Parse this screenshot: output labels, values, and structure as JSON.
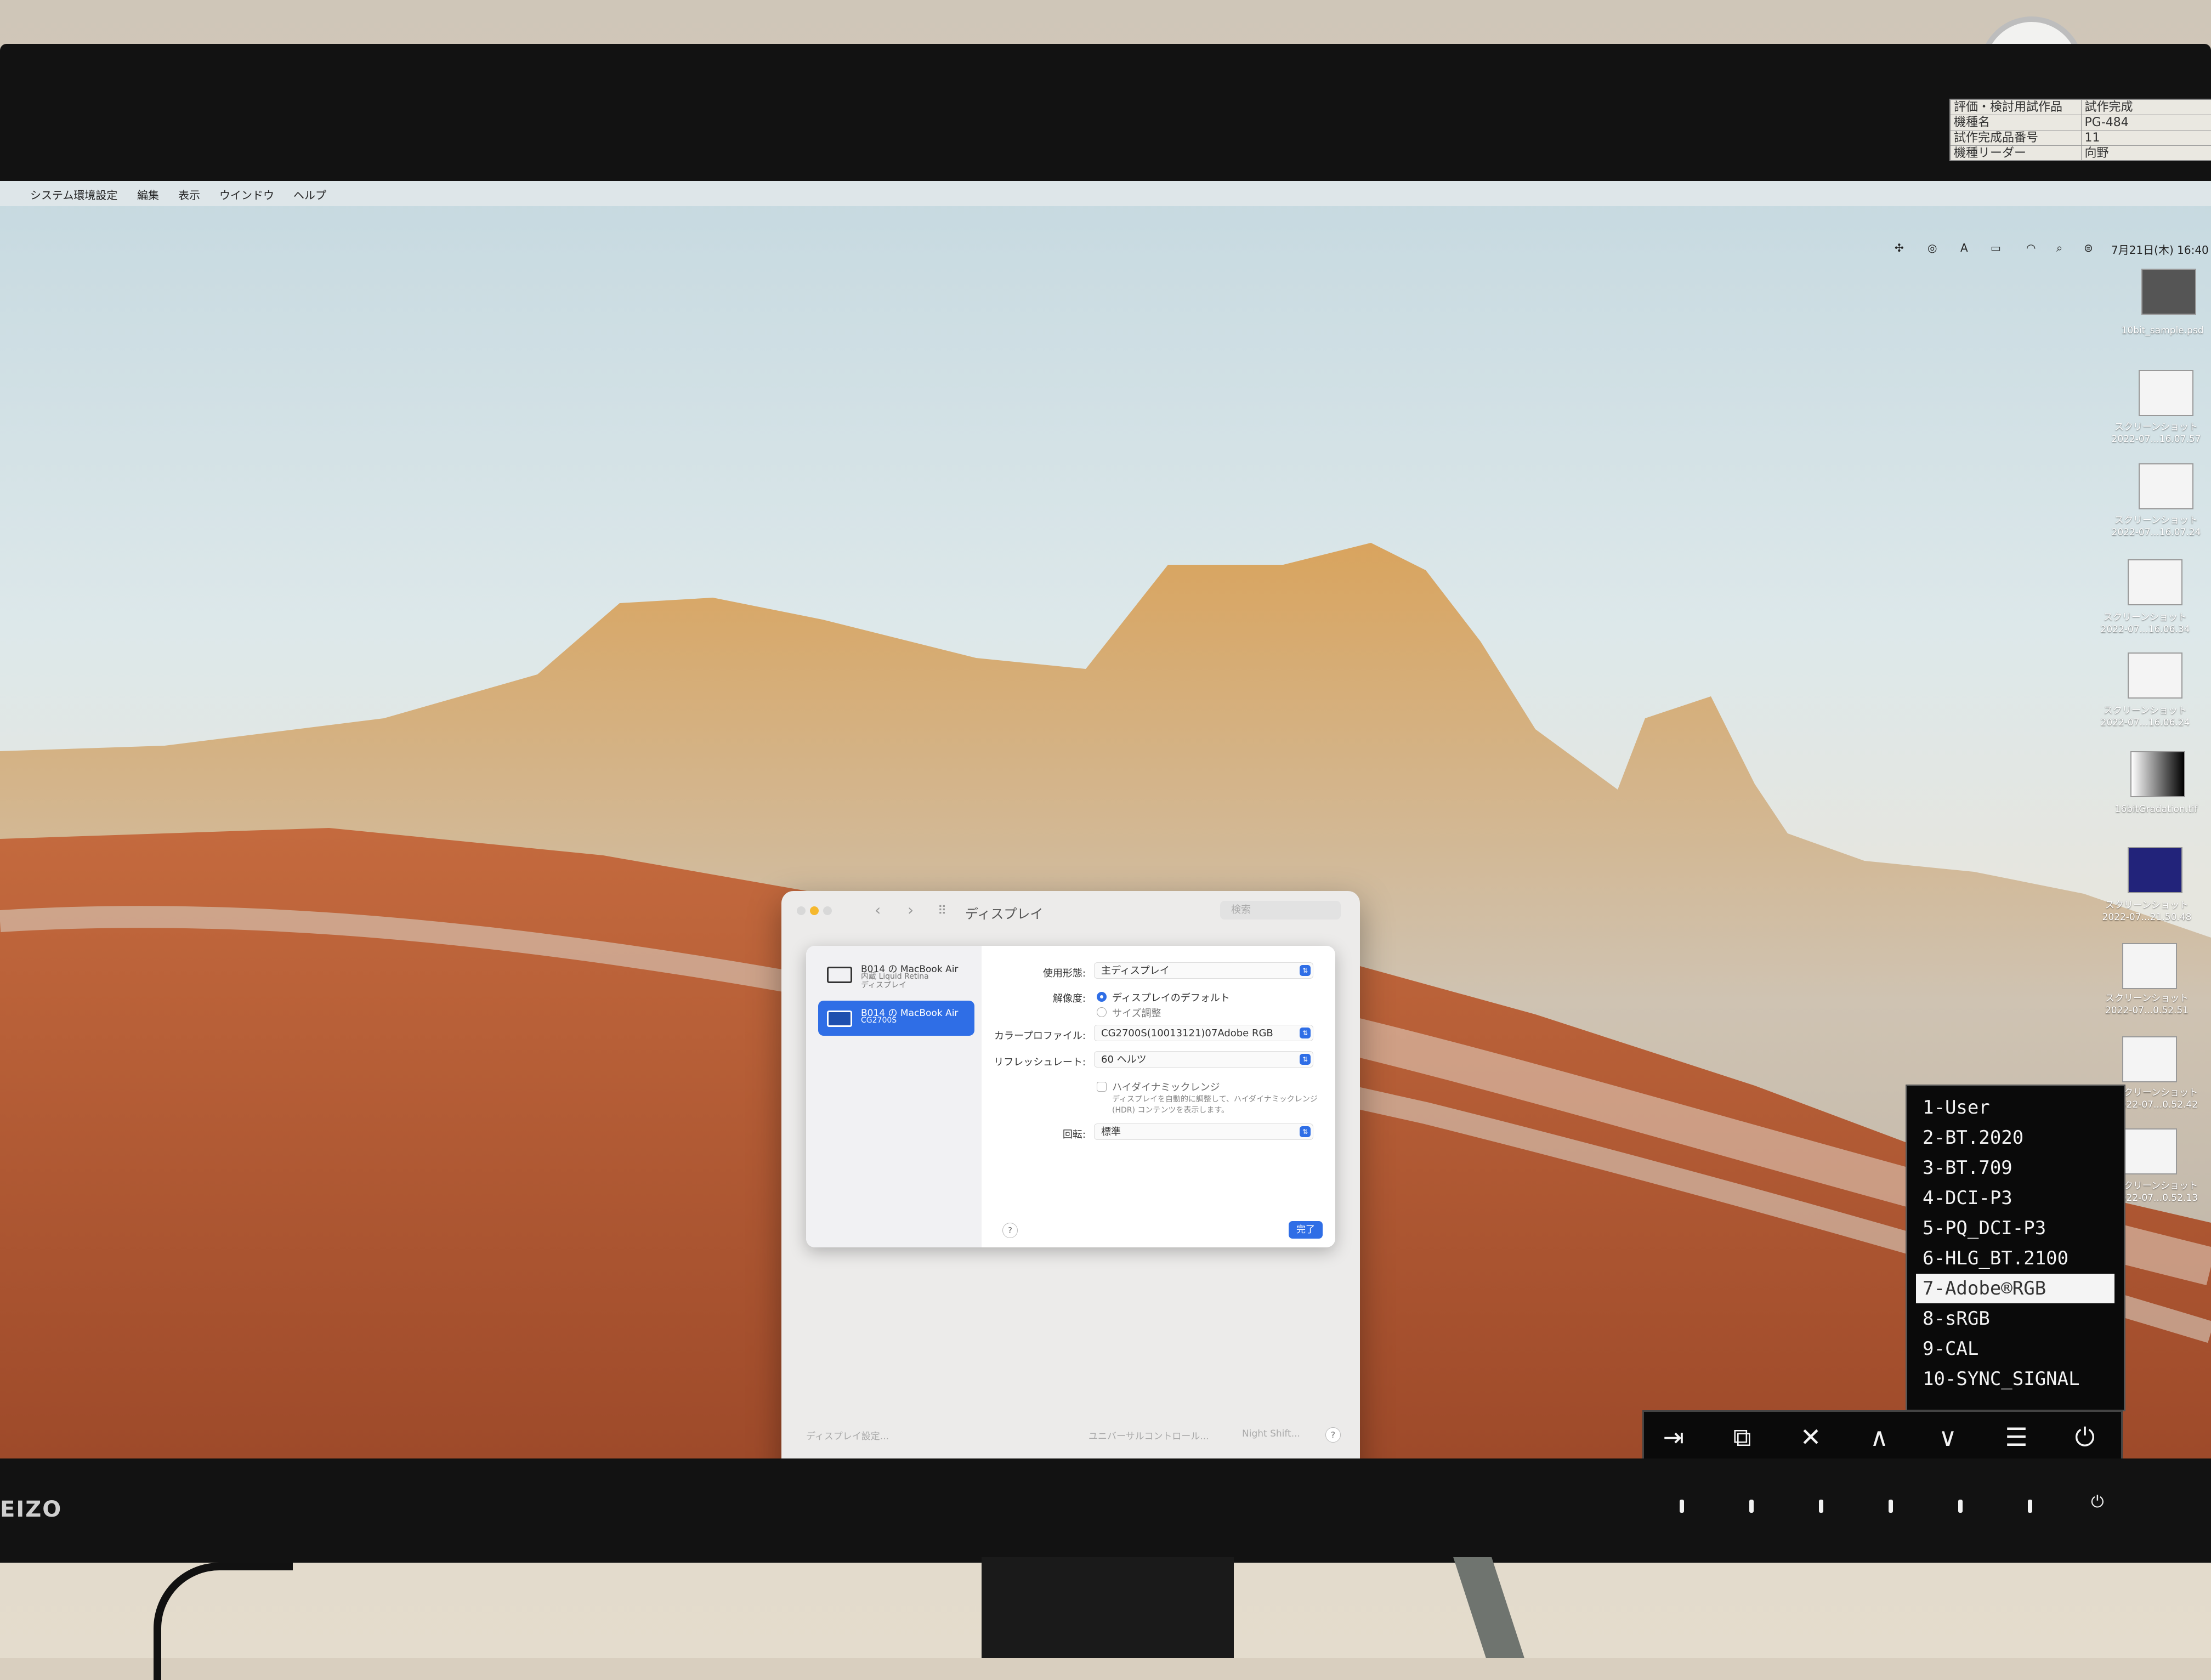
{
  "menubar": {
    "apple": "",
    "items": [
      "システム環境設定",
      "編集",
      "表示",
      "ウインドウ",
      "ヘルプ"
    ]
  },
  "statusbar": {
    "input_indicator": "A",
    "datetime": "7月21日(木) 16:40"
  },
  "sticker": {
    "rows": [
      [
        "評価・検討用試作品",
        "試作完成"
      ],
      [
        "機種名",
        "PG-484",
        ""
      ],
      [
        "試作完成品番号",
        "11",
        ""
      ],
      [
        "機種リーダー",
        "向野",
        ""
      ]
    ]
  },
  "desktop_icons": [
    {
      "label": "10bit_sample.psd"
    },
    {
      "label": "スクリーンショット\n2022-07...16.07.57"
    },
    {
      "label": "スクリーンショット\n2022-07...16.07.24"
    },
    {
      "label": "スクリーンショット\n2022-07...16.06.34"
    },
    {
      "label": "スクリーンショット\n2022-07...16.06.24"
    },
    {
      "label": "16bitGradation.tif"
    },
    {
      "label": "スクリーンショット\n2022-07...21.50.48"
    },
    {
      "label": "スクリーンショット\n2022-07...0.52.51"
    },
    {
      "label": "スクリーンショット\n2022-07...0.52.42"
    },
    {
      "label": "スクリーンショット\n2022-07...0.52.13"
    }
  ],
  "window": {
    "title": "ディスプレイ",
    "search_placeholder": "検索",
    "nav_back": "‹",
    "nav_forward": "›",
    "sidebar": [
      {
        "line1": "B014 の MacBook Air",
        "line2": "内蔵 Liquid Retina\nディスプレイ",
        "selected": false
      },
      {
        "line1": "B014 の MacBook Air",
        "line2": "CG2700S",
        "selected": true
      }
    ],
    "form": {
      "use_as_label": "使用形態:",
      "use_as_value": "主ディスプレイ",
      "resolution_label": "解像度:",
      "resolution_options": [
        "ディスプレイのデフォルト",
        "サイズ調整"
      ],
      "color_profile_label": "カラープロファイル:",
      "color_profile_value": "CG2700S(10013121)07Adobe RGB",
      "refresh_label": "リフレッシュレート:",
      "refresh_value": "60 ヘルツ",
      "hdr_label": "ハイダイナミックレンジ",
      "hdr_hint": "ディスプレイを自動的に調整して、ハイダイナミックレンジ (HDR) コンテンツを表示します。",
      "rotation_label": "回転:",
      "rotation_value": "標準",
      "help": "?",
      "done": "完了"
    },
    "footer": {
      "display_settings": "ディスプレイ設定...",
      "universal_control": "ユニバーサルコントロール...",
      "night_shift": "Night Shift...",
      "help": "?"
    }
  },
  "osd": {
    "modes": [
      "1-User",
      "2-BT.2020",
      "3-BT.709",
      "4-DCI-P3",
      "5-PQ_DCI-P3",
      "6-HLG_BT.2100",
      "7-Adobe®RGB",
      "8-sRGB",
      "9-CAL",
      "10-SYNC_SIGNAL"
    ],
    "selected_index": 6,
    "buttons": [
      "⇥",
      "⧉",
      "✕",
      "∧",
      "∨",
      "☰",
      "⏻"
    ]
  },
  "monitor": {
    "brand": "EIZO",
    "power_glyph": "⏻"
  }
}
